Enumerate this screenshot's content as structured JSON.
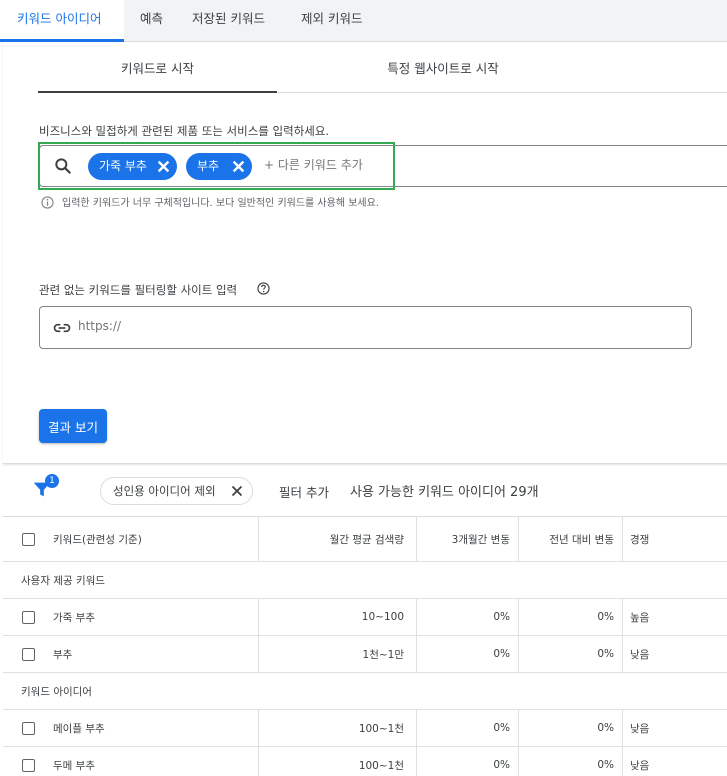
{
  "top_tabs": {
    "ideas": "키워드 아이디어",
    "forecast": "예측",
    "saved": "저장된 키워드",
    "excluded": "제외 키워드"
  },
  "sub_tabs": {
    "start_keywords": "키워드로 시작",
    "start_website": "특정 웹사이트로 시작"
  },
  "keyword_section": {
    "description": "비즈니스와 밀접하게 관련된 제품 또는 서비스를 입력하세요.",
    "chips": [
      "가죽 부추",
      "부추"
    ],
    "add_placeholder": "+ 다른 키워드 추가",
    "warning": "입력한 키워드가 너무 구체적입니다. 보다 일반적인 키워드를 사용해 보세요."
  },
  "site_section": {
    "label": "관련 없는 키워드를 필터링할 사이트 입력",
    "placeholder": "https://"
  },
  "results_button": "결과 보기",
  "filter_bar": {
    "badge_count": "1",
    "active_filter": "성인용 아이디어 제외",
    "add_filter": "필터 추가",
    "available": "사용 가능한 키워드 아이디어 29개"
  },
  "table": {
    "headers": {
      "keyword": "키워드(관련성 기준)",
      "volume": "월간 평균 검색량",
      "three_month": "3개월간 변동",
      "yoy": "전년 대비 변동",
      "competition": "경쟁"
    },
    "groups": [
      {
        "label": "사용자 제공 키워드",
        "rows": [
          {
            "keyword": "가죽 부추",
            "volume": "10~100",
            "three_month": "0%",
            "yoy": "0%",
            "competition": "높음"
          },
          {
            "keyword": "부추",
            "volume": "1천~1만",
            "three_month": "0%",
            "yoy": "0%",
            "competition": "낮음"
          }
        ]
      },
      {
        "label": "키워드 아이디어",
        "rows": [
          {
            "keyword": "메이플 부추",
            "volume": "100~1천",
            "three_month": "0%",
            "yoy": "0%",
            "competition": "낮음"
          },
          {
            "keyword": "두메 부추",
            "volume": "100~1천",
            "three_month": "0%",
            "yoy": "0%",
            "competition": "낮음"
          }
        ]
      }
    ]
  },
  "colors": {
    "accent": "#1a73e8",
    "highlight": "#34a853"
  }
}
